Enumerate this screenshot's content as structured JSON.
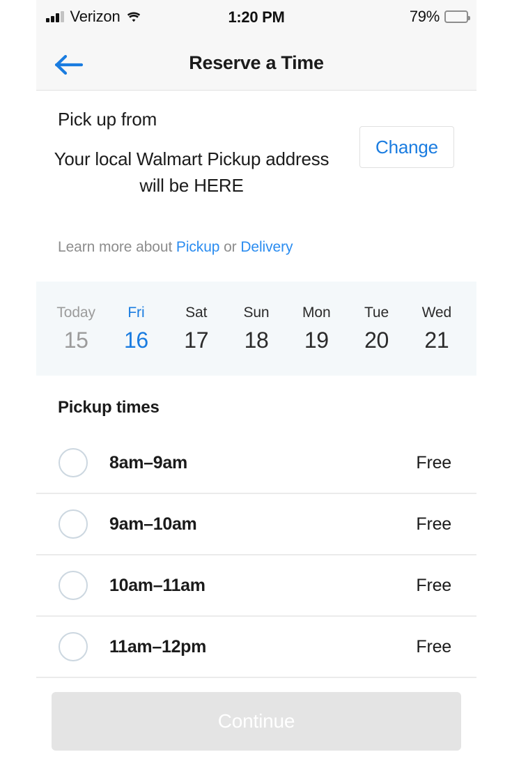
{
  "status_bar": {
    "carrier": "Verizon",
    "time": "1:20 PM",
    "battery_percent": "79%",
    "signal_icon": "signal-bars-icon",
    "wifi_icon": "wifi-icon",
    "battery_icon": "battery-icon"
  },
  "nav": {
    "title": "Reserve a Time",
    "back_icon": "back-arrow-icon"
  },
  "pickup": {
    "section_label": "Pick up from",
    "address": "Your local Walmart Pickup address will be HERE",
    "change_label": "Change"
  },
  "learn_more": {
    "prefix": "Learn more about ",
    "link1": "Pickup",
    "middle": " or ",
    "link2": "Delivery"
  },
  "dates": [
    {
      "dow": "Today",
      "day": "15",
      "state": "disabled"
    },
    {
      "dow": "Fri",
      "day": "16",
      "state": "selected"
    },
    {
      "dow": "Sat",
      "day": "17",
      "state": "normal"
    },
    {
      "dow": "Sun",
      "day": "18",
      "state": "normal"
    },
    {
      "dow": "Mon",
      "day": "19",
      "state": "normal"
    },
    {
      "dow": "Tue",
      "day": "20",
      "state": "normal"
    },
    {
      "dow": "Wed",
      "day": "21",
      "state": "normal"
    }
  ],
  "times": {
    "title": "Pickup times",
    "slots": [
      {
        "label": "8am–9am",
        "price": "Free",
        "selected": false
      },
      {
        "label": "9am–10am",
        "price": "Free",
        "selected": false
      },
      {
        "label": "10am–11am",
        "price": "Free",
        "selected": false
      },
      {
        "label": "11am–12pm",
        "price": "Free",
        "selected": false
      }
    ]
  },
  "footer": {
    "continue_label": "Continue",
    "continue_enabled": false
  },
  "colors": {
    "accent_blue": "#1a7ce0",
    "link_blue": "#2a8cf0",
    "text_dark": "#1b1b1b",
    "text_muted": "#8d8d8d",
    "chrome_gray": "#f7f7f7",
    "date_strip_bg": "#f4f8fa",
    "divider": "#ebebeb",
    "disabled_button": "#e4e4e4"
  }
}
